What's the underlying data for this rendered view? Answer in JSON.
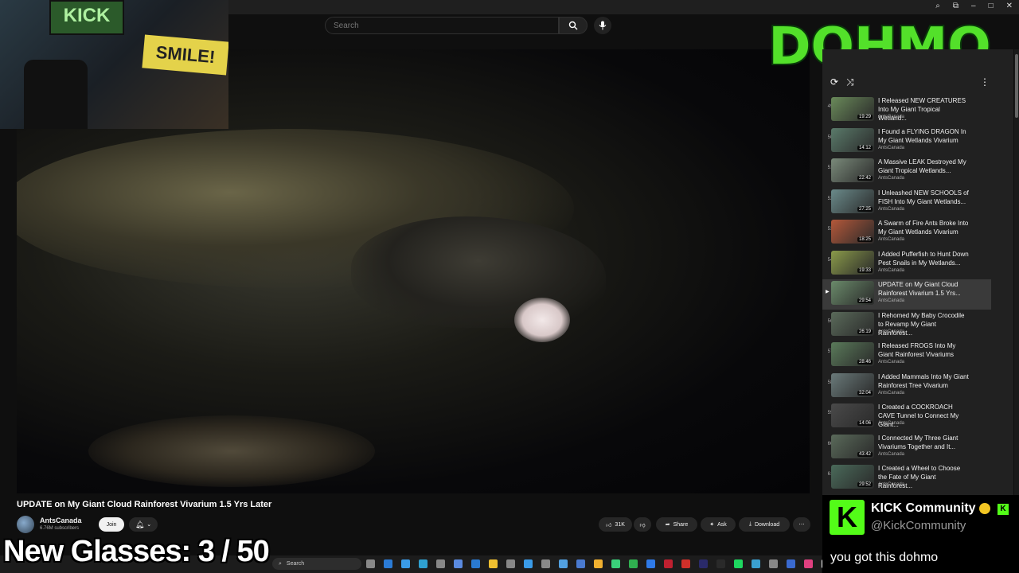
{
  "header": {
    "search_placeholder": "Search"
  },
  "webcam": {
    "flag_text": "KICK",
    "banner_text": "SMILE!"
  },
  "logo": {
    "text": "DOHMO"
  },
  "video": {
    "title": "UPDATE on My Giant Cloud Rainforest Vivarium 1.5 Yrs Later",
    "channel": "AntsCanada",
    "subscribers": "6.76M subscribers",
    "join_label": "Join",
    "likes": "31K",
    "share_label": "Share",
    "ask_label": "Ask",
    "download_label": "Download"
  },
  "overlay": {
    "glasses_counter": "New Glasses:  3 / 50"
  },
  "taskbar": {
    "search_label": "Search"
  },
  "playlist": {
    "items": [
      {
        "index": "49",
        "title": "I Released NEW CREATURES Into My Giant Tropical Wetland...",
        "channel": "AntsCanada",
        "duration": "19:29",
        "color": "#6a8a5a"
      },
      {
        "index": "50",
        "title": "I Found a FLYING DRAGON In My Giant Wetlands Vivarium",
        "channel": "AntsCanada",
        "duration": "14:12",
        "color": "#5a7a6a"
      },
      {
        "index": "51",
        "title": "A Massive LEAK Destroyed My Giant Tropical Wetlands...",
        "channel": "AntsCanada",
        "duration": "22:42",
        "color": "#7a8a7a"
      },
      {
        "index": "52",
        "title": "I Unleashed NEW SCHOOLS of FISH Into My Giant Wetlands...",
        "channel": "AntsCanada",
        "duration": "27:25",
        "color": "#6a8a8a"
      },
      {
        "index": "53",
        "title": "A Swarm of Fire Ants Broke Into My Giant Wetlands Vivarium",
        "channel": "AntsCanada",
        "duration": "18:25",
        "color": "#b4583a"
      },
      {
        "index": "54",
        "title": "I Added Pufferfish to Hunt Down Pest Snails in My Wetlands...",
        "channel": "AntsCanada",
        "duration": "19:33",
        "color": "#8a9a4a"
      },
      {
        "index": "",
        "title": "UPDATE on My Giant Cloud Rainforest Vivarium 1.5 Yrs...",
        "channel": "AntsCanada",
        "duration": "29:54",
        "color": "#6a8a6a",
        "active": true
      },
      {
        "index": "56",
        "title": "I Rehomed My Baby Crocodile to Revamp My Giant Rainforest...",
        "channel": "AntsCanada",
        "duration": "26:19",
        "color": "#5a6a5a"
      },
      {
        "index": "57",
        "title": "I Released FROGS Into My Giant Rainforest Vivariums",
        "channel": "AntsCanada",
        "duration": "28:46",
        "color": "#5a7a5a"
      },
      {
        "index": "58",
        "title": "I Added Mammals Into My Giant Rainforest Tree Vivarium",
        "channel": "AntsCanada",
        "duration": "32:04",
        "color": "#6a7a7a"
      },
      {
        "index": "59",
        "title": "I Created a COCKROACH CAVE Tunnel to Connect My Giant...",
        "channel": "AntsCanada",
        "duration": "14:06",
        "color": "#4a4a4a"
      },
      {
        "index": "60",
        "title": "I Connected My Three Giant Vivariums Together and It...",
        "channel": "AntsCanada",
        "duration": "43:42",
        "color": "#5a6a5a"
      },
      {
        "index": "61",
        "title": "I Created a Wheel to Choose the Fate of My Giant Rainforest...",
        "channel": "AntsCanada",
        "duration": "29:52",
        "color": "#4a6a5a"
      }
    ]
  },
  "kick_card": {
    "name": "KICK Community",
    "handle": "@KickCommunity",
    "message": "you got this dohmo"
  }
}
